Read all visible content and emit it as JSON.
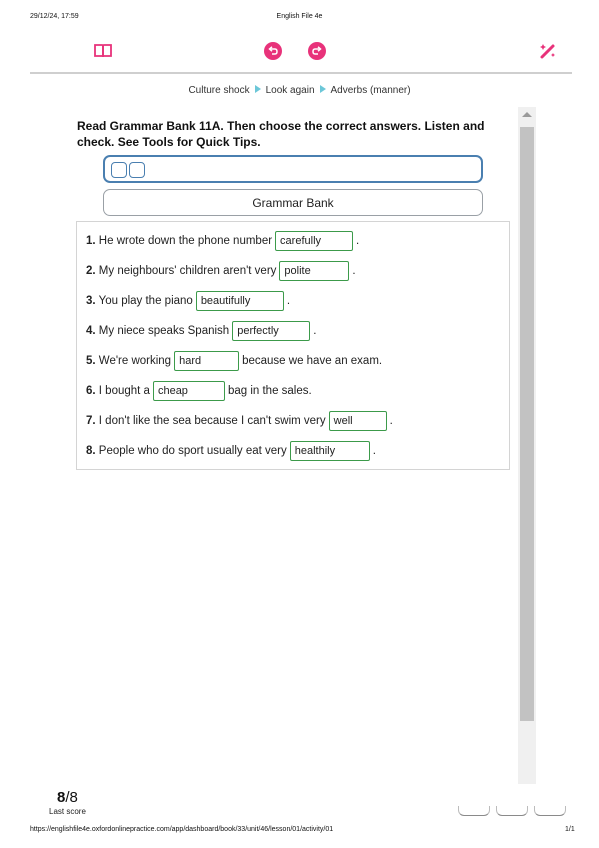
{
  "print_header": {
    "date": "29/12/24, 17:59",
    "title": "English File 4e"
  },
  "toolbar": {
    "icons": [
      "book-icon",
      "undo-icon",
      "redo-icon",
      "magic-wand-icon"
    ],
    "accent": "#e8327a"
  },
  "breadcrumb": [
    "Culture shock",
    "Look again",
    "Adverbs (manner)"
  ],
  "instructions": "Read Grammar Bank 11A. Then choose the correct answers. Listen and check. See Tools for Quick Tips.",
  "grammar_bank_label": "Grammar Bank",
  "questions": [
    {
      "num": "1.",
      "before": "He wrote down the phone number",
      "answer": "carefully",
      "after": "."
    },
    {
      "num": "2.",
      "before": "My neighbours' children aren't very",
      "answer": "polite",
      "after": "."
    },
    {
      "num": "3.",
      "before": "You play the piano",
      "answer": "beautifully",
      "after": "."
    },
    {
      "num": "4.",
      "before": "My niece speaks Spanish",
      "answer": "perfectly",
      "after": "."
    },
    {
      "num": "5.",
      "before": "We're working",
      "answer": "hard",
      "after": "because we have an exam."
    },
    {
      "num": "6.",
      "before": "I bought a",
      "answer": "cheap",
      "after": "bag in the sales."
    },
    {
      "num": "7.",
      "before": "I don't like the sea because I can't swim very",
      "answer": "well",
      "after": "."
    },
    {
      "num": "8.",
      "before": "People who do sport usually eat very",
      "answer": "healthily",
      "after": "."
    }
  ],
  "score": {
    "value": "8",
    "total": "/8",
    "label": "Last score"
  },
  "print_footer": {
    "url": "https://englishfile4e.oxfordonlinepractice.com/app/dashboard/book/33/unit/46/lesson/01/activity/01",
    "page": "1/1"
  },
  "colors": {
    "accent": "#e8327a",
    "answer_border": "#3c9a4a",
    "tools_border": "#4a7fb0",
    "breadcrumb_arrow": "#6cc7d8"
  }
}
